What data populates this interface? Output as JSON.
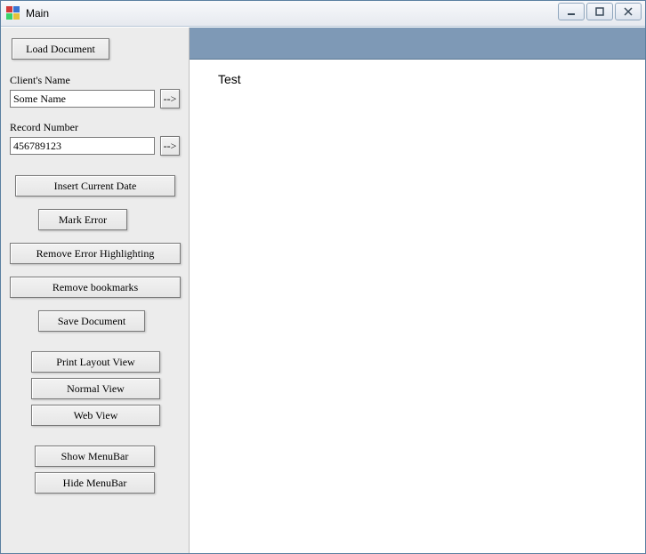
{
  "window": {
    "title": "Main"
  },
  "sidebar": {
    "load_document": "Load Document",
    "client_name_label": "Client's Name",
    "client_name_value": "Some Name",
    "client_name_arrow": "-->",
    "record_number_label": "Record Number",
    "record_number_value": "456789123",
    "record_number_arrow": "-->",
    "insert_current_date": "Insert Current Date",
    "mark_error": "Mark Error",
    "remove_error_highlighting": "Remove Error Highlighting",
    "remove_bookmarks": "Remove bookmarks",
    "save_document": "Save Document",
    "print_layout_view": "Print Layout View",
    "normal_view": "Normal View",
    "web_view": "Web View",
    "show_menubar": "Show MenuBar",
    "hide_menubar": "Hide MenuBar"
  },
  "document": {
    "body_text": "Test"
  }
}
